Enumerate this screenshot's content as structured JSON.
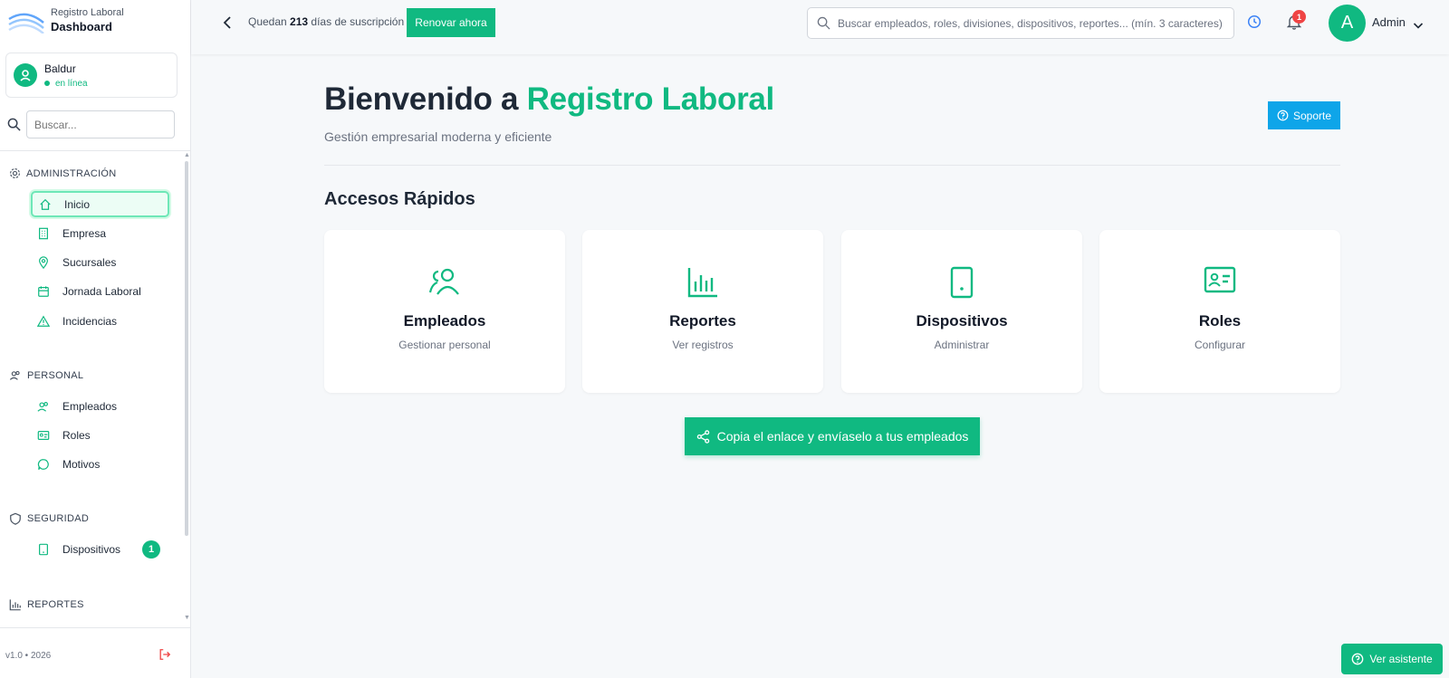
{
  "brand": {
    "subtitle": "Registro Laboral",
    "title": "Dashboard"
  },
  "user": {
    "name": "Baldur",
    "status": "en línea"
  },
  "sidebar_search": {
    "placeholder": "Buscar..."
  },
  "sections": {
    "admin": "ADMINISTRACIÓN",
    "personal": "PERSONAL",
    "security": "SEGURIDAD",
    "reports": "REPORTES"
  },
  "nav": {
    "inicio": "Inicio",
    "empresa": "Empresa",
    "sucursales": "Sucursales",
    "jornada": "Jornada Laboral",
    "incidencias": "Incidencias",
    "empleados": "Empleados",
    "roles": "Roles",
    "motivos": "Motivos",
    "dispositivos": "Dispositivos",
    "dispositivos_badge": "1"
  },
  "footer": {
    "version": "v1.0 • 2026"
  },
  "topbar": {
    "sub_prefix": "Quedan",
    "sub_days": "213",
    "sub_suffix": "días de suscripción",
    "renew_label": "Renovar ahora",
    "search_placeholder": "Buscar empleados, roles, divisiones, dispositivos, reportes... (mín. 3 caracteres)",
    "notifications_count": "1",
    "avatar_letter": "A",
    "user_label": "Admin"
  },
  "hero": {
    "title_prefix": "Bienvenido a",
    "title_accent": "Registro Laboral",
    "subtitle": "Gestión empresarial moderna y eficiente",
    "support_label": "Soporte"
  },
  "quick": {
    "title": "Accesos Rápidos",
    "cards": [
      {
        "title": "Empleados",
        "desc": "Gestionar personal",
        "icon": "users-icon"
      },
      {
        "title": "Reportes",
        "desc": "Ver registros",
        "icon": "bar-chart-icon"
      },
      {
        "title": "Dispositivos",
        "desc": "Administrar",
        "icon": "tablet-icon"
      },
      {
        "title": "Roles",
        "desc": "Configurar",
        "icon": "id-card-icon"
      }
    ]
  },
  "copy_link_label": "Copia el enlace y envíaselo a tus empleados",
  "assistant_label": "Ver asistente",
  "colors": {
    "accent": "#10b981",
    "support": "#0ea5e9",
    "alert": "#ef4444"
  }
}
